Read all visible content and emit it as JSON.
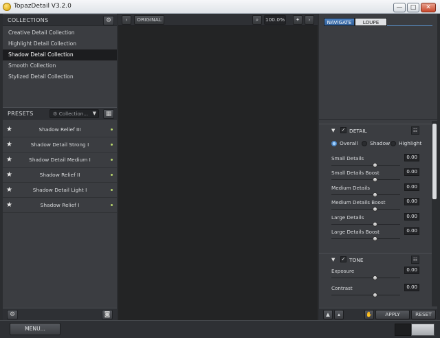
{
  "window": {
    "title": "TopazDetail V3.2.0",
    "minimize_glyph": "—",
    "maximize_glyph": "□",
    "close_glyph": "✕"
  },
  "collections": {
    "header": "COLLECTIONS",
    "settings_icon": "gear-icon",
    "items": [
      {
        "label": "Creative Detail Collection"
      },
      {
        "label": "Highlight Detail Collection"
      },
      {
        "label": "Shadow Detail Collection"
      },
      {
        "label": "Smooth Collection"
      },
      {
        "label": "Stylized Detail Collection"
      }
    ],
    "active_index": 2
  },
  "presets": {
    "header": "PRESETS",
    "dropdown_value": "Collection...",
    "grid_icon": "grid-icon",
    "items": [
      {
        "label": "Shadow Relief III"
      },
      {
        "label": "Shadow Detail Strong I"
      },
      {
        "label": "Shadow Detail Medium I"
      },
      {
        "label": "Shadow Relief II"
      },
      {
        "label": "Shadow Detail Light I"
      },
      {
        "label": "Shadow Relief I"
      }
    ]
  },
  "center": {
    "prev_glyph": "‹",
    "next_glyph": "›",
    "original_label": "ORIGINAL",
    "zoom": "100.0%"
  },
  "navigator": {
    "tabs": [
      {
        "label": "NAVIGATE"
      },
      {
        "label": "LOUPE"
      }
    ],
    "active_tab": 0
  },
  "detail": {
    "title": "DETAIL",
    "enabled": true,
    "modes": [
      "Overall",
      "Shadow",
      "Highlight"
    ],
    "selected_mode": 0,
    "sliders": [
      {
        "label": "Small Details",
        "value": "0.00"
      },
      {
        "label": "Small Details Boost",
        "value": "0.00"
      },
      {
        "label": "Medium Details",
        "value": "0.00"
      },
      {
        "label": "Medium Details Boost",
        "value": "0.00"
      },
      {
        "label": "Large Details",
        "value": "0.00"
      },
      {
        "label": "Large Details Boost",
        "value": "0.00"
      }
    ]
  },
  "tone": {
    "title": "TONE",
    "enabled": true,
    "sliders": [
      {
        "label": "Exposure",
        "value": "0.00"
      },
      {
        "label": "Contrast",
        "value": "0.00"
      }
    ]
  },
  "footer": {
    "apply_label": "APPLY",
    "reset_label": "RESET",
    "menu_label": "MENU..."
  },
  "colors": {
    "accent_blue": "#3a6fb0",
    "panel": "#3b3d41",
    "canvas": "#232425",
    "preset_dot": "#b9d86c"
  }
}
